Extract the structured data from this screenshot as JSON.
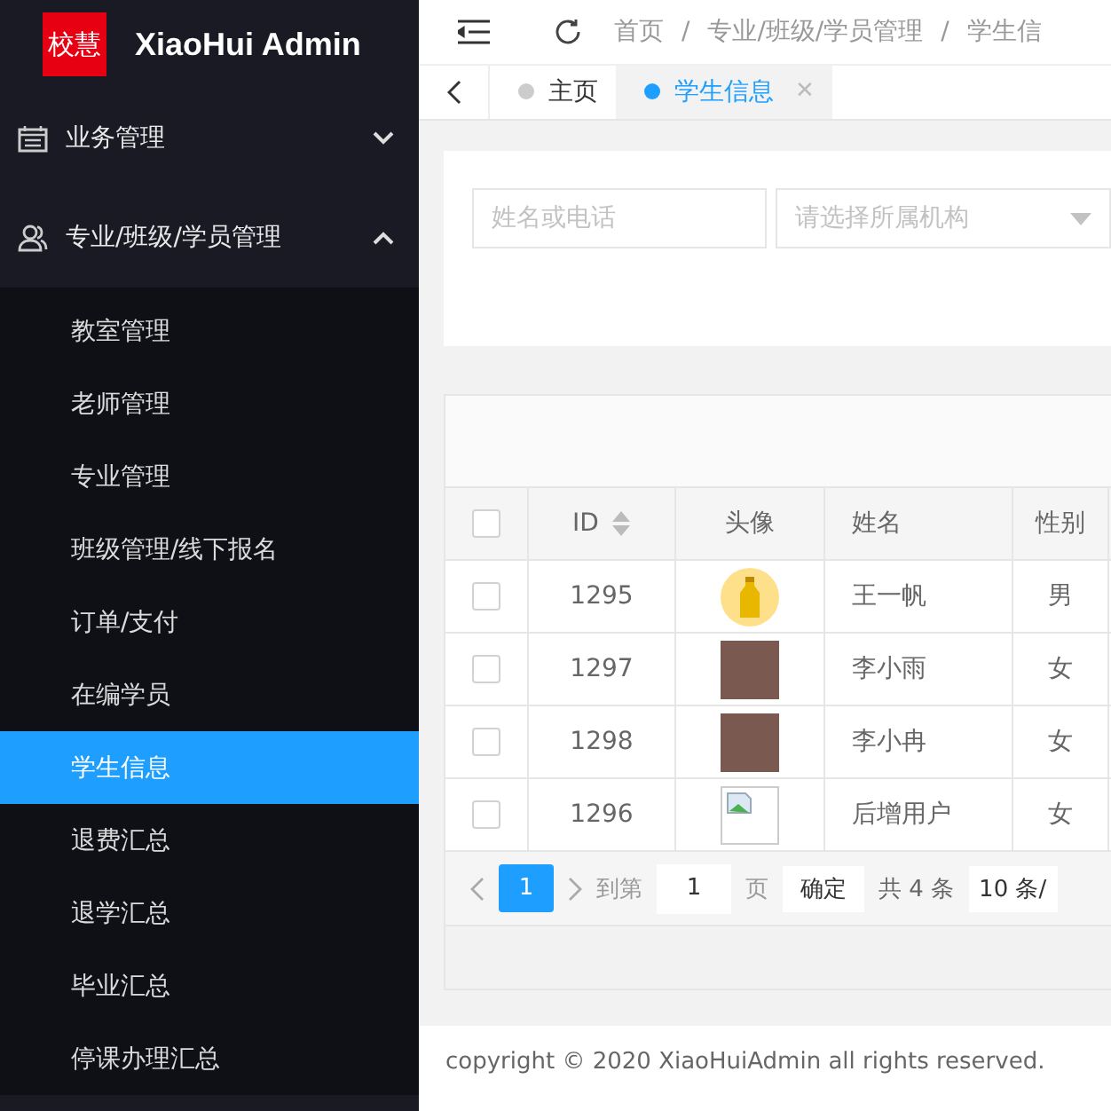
{
  "sidebar": {
    "logo": {
      "badge": "校慧",
      "title": "XiaoHui Admin"
    },
    "menu": [
      {
        "label": "业务管理",
        "expanded": false
      },
      {
        "label": "专业/班级/学员管理",
        "expanded": true,
        "children": [
          {
            "label": "教室管理",
            "selected": false
          },
          {
            "label": "老师管理",
            "selected": false
          },
          {
            "label": "专业管理",
            "selected": false
          },
          {
            "label": "班级管理/线下报名",
            "selected": false
          },
          {
            "label": "订单/支付",
            "selected": false
          },
          {
            "label": "在编学员",
            "selected": false
          },
          {
            "label": "学生信息",
            "selected": true
          },
          {
            "label": "退费汇总",
            "selected": false
          },
          {
            "label": "退学汇总",
            "selected": false
          },
          {
            "label": "毕业汇总",
            "selected": false
          },
          {
            "label": "停课办理汇总",
            "selected": false
          }
        ]
      }
    ]
  },
  "header": {
    "breadcrumb": [
      {
        "kind": "link",
        "label": "首页"
      },
      {
        "kind": "separator",
        "label": "/"
      },
      {
        "kind": "link",
        "label": "专业/班级/学员管理"
      },
      {
        "kind": "separator",
        "label": "/"
      },
      {
        "kind": "link",
        "label": "学生信"
      }
    ]
  },
  "tabs": [
    {
      "label": "主页",
      "selected": false
    },
    {
      "label": "学生信息",
      "selected": true,
      "close": "✕"
    }
  ],
  "search": {
    "fields": [
      {
        "kind": "input",
        "placeholder": "姓名或电话"
      },
      {
        "kind": "select",
        "placeholder": "请选择所属机构"
      }
    ]
  },
  "table": {
    "header_checked": false,
    "columns": [
      {
        "label": "ID",
        "sortable": true
      },
      {
        "label": "头像",
        "sortable": false
      },
      {
        "label": "姓名",
        "sortable": false
      },
      {
        "label": "性别",
        "sortable": false
      }
    ],
    "rows": [
      {
        "checked": false,
        "id": "1295",
        "avatar": {
          "kind": "cartoon"
        },
        "name": "王一帆",
        "gender": "男"
      },
      {
        "checked": false,
        "id": "1297",
        "avatar": {
          "kind": "photo"
        },
        "name": "李小雨",
        "gender": "女"
      },
      {
        "checked": false,
        "id": "1298",
        "avatar": {
          "kind": "photo"
        },
        "name": "李小冉",
        "gender": "女"
      },
      {
        "checked": false,
        "id": "1296",
        "avatar": {
          "kind": "broken"
        },
        "name": "后增用户",
        "gender": "女"
      }
    ]
  },
  "pagination": {
    "pages": [
      {
        "label": "1",
        "selected": true
      }
    ],
    "goto_label": "到第",
    "goto_value": "1",
    "page_unit": "页",
    "confirm": "确定",
    "total": "共 4 条",
    "page_size": "10 条/"
  },
  "footer": {
    "copyright": "copyright © 2020 XiaoHuiAdmin all rights reserved."
  }
}
